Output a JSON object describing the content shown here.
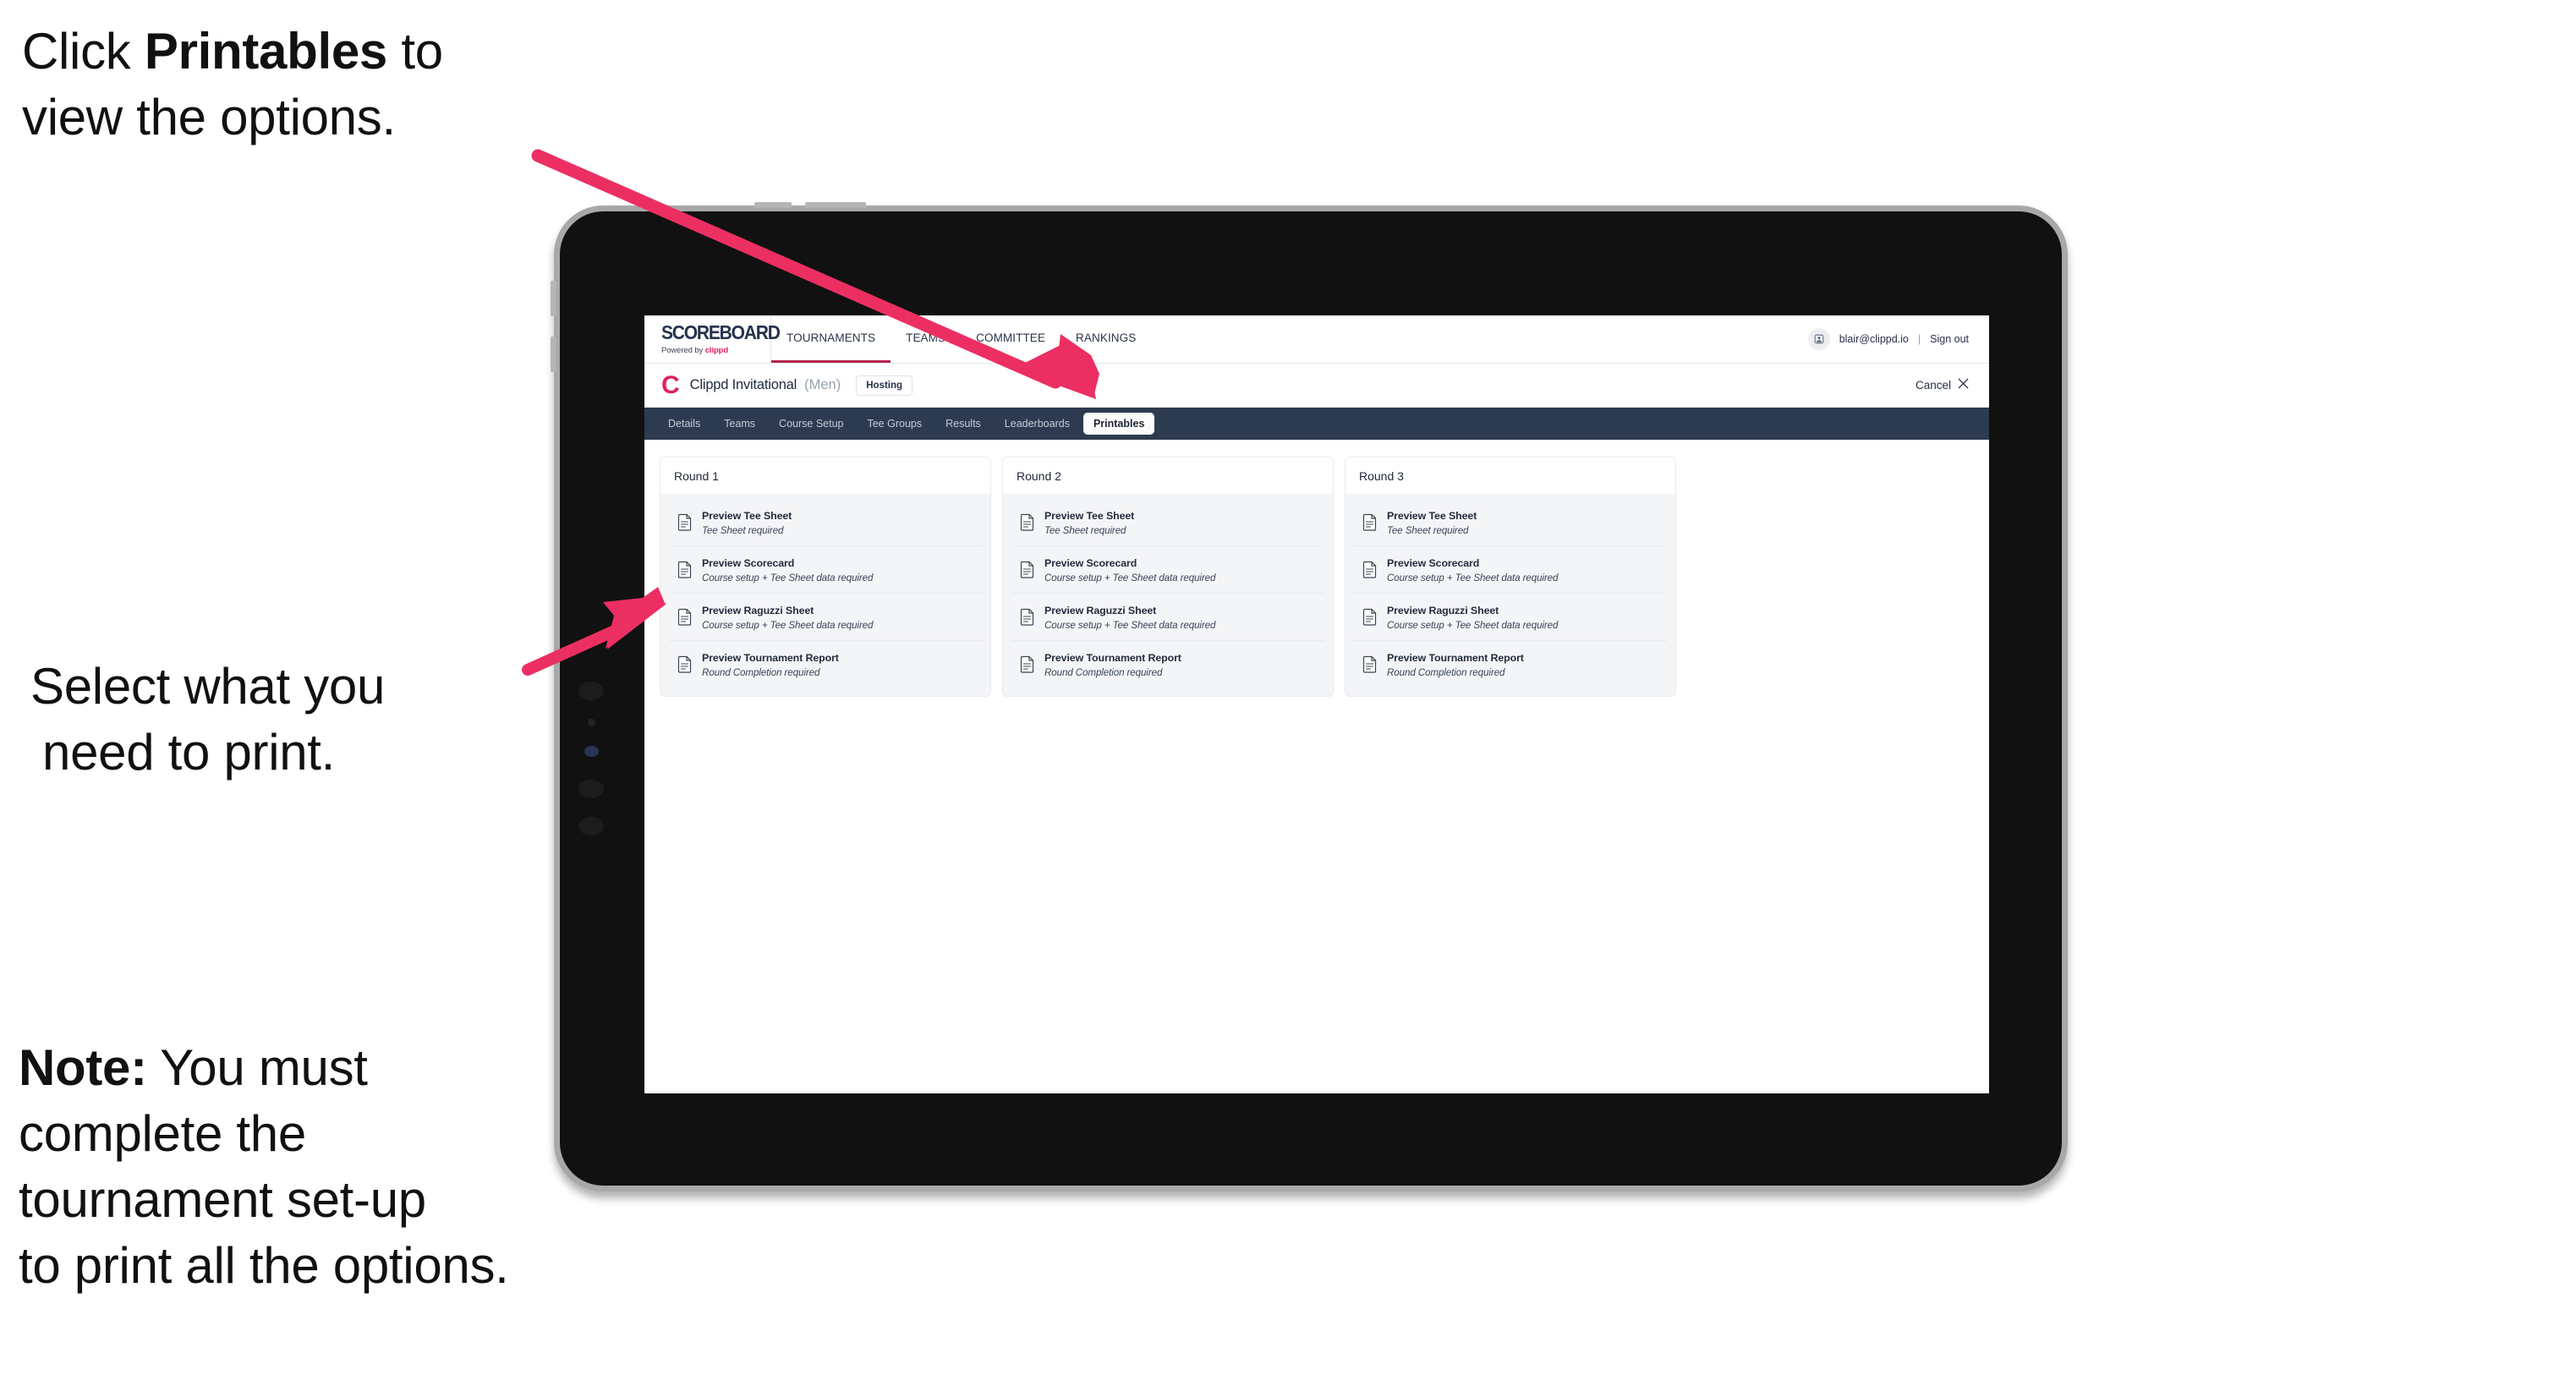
{
  "annotations": {
    "click_printables": "Click ",
    "click_printables_bold": "Printables",
    "click_printables_tail": " to\nview the options.",
    "select_line1": "Select what you",
    "select_line2": "need to print.",
    "note_bold": "Note:",
    "note_text": " You must\ncomplete the\ntournament set-up\nto print all the options."
  },
  "browser": {
    "site_bar": {
      "logo_word": "SCOREBOARD",
      "logo_sub_prefix": "Powered by ",
      "logo_sub_brand": "clippd",
      "nav_items": [
        {
          "label": "TOURNAMENTS",
          "active": true
        },
        {
          "label": "TEAMS",
          "active": false
        },
        {
          "label": "COMMITTEE",
          "active": false
        },
        {
          "label": "RANKINGS",
          "active": false
        }
      ],
      "avatar_icon": "user-avatar-icon",
      "account_email": "blair@clippd.io",
      "divider": "|",
      "sign_out": "Sign out"
    },
    "tournament_bar": {
      "brand_mark": "C",
      "name": "Clippd Invitational",
      "gender": "(Men)",
      "hosting_badge": "Hosting",
      "cancel_label": "Cancel",
      "cancel_icon": "close-x-icon"
    },
    "tabs": [
      {
        "label": "Details",
        "active": false
      },
      {
        "label": "Teams",
        "active": false
      },
      {
        "label": "Course Setup",
        "active": false
      },
      {
        "label": "Tee Groups",
        "active": false
      },
      {
        "label": "Results",
        "active": false
      },
      {
        "label": "Leaderboards",
        "active": false
      },
      {
        "label": "Printables",
        "active": true
      }
    ],
    "rounds": [
      {
        "title": "Round 1",
        "items": [
          {
            "title": "Preview Tee Sheet",
            "requirement": "Tee Sheet required",
            "icon": "document-icon"
          },
          {
            "title": "Preview Scorecard",
            "requirement": "Course setup + Tee Sheet data required",
            "icon": "document-icon"
          },
          {
            "title": "Preview Raguzzi Sheet",
            "requirement": "Course setup + Tee Sheet data required",
            "icon": "document-icon"
          },
          {
            "title": "Preview Tournament Report",
            "requirement": "Round Completion required",
            "icon": "document-icon"
          }
        ]
      },
      {
        "title": "Round 2",
        "items": [
          {
            "title": "Preview Tee Sheet",
            "requirement": "Tee Sheet required",
            "icon": "document-icon"
          },
          {
            "title": "Preview Scorecard",
            "requirement": "Course setup + Tee Sheet data required",
            "icon": "document-icon"
          },
          {
            "title": "Preview Raguzzi Sheet",
            "requirement": "Course setup + Tee Sheet data required",
            "icon": "document-icon"
          },
          {
            "title": "Preview Tournament Report",
            "requirement": "Round Completion required",
            "icon": "document-icon"
          }
        ]
      },
      {
        "title": "Round 3",
        "items": [
          {
            "title": "Preview Tee Sheet",
            "requirement": "Tee Sheet required",
            "icon": "document-icon"
          },
          {
            "title": "Preview Scorecard",
            "requirement": "Course setup + Tee Sheet data required",
            "icon": "document-icon"
          },
          {
            "title": "Preview Raguzzi Sheet",
            "requirement": "Course setup + Tee Sheet data required",
            "icon": "document-icon"
          },
          {
            "title": "Preview Tournament Report",
            "requirement": "Round Completion required",
            "icon": "document-icon"
          }
        ]
      }
    ]
  },
  "colors": {
    "annotation_arrow": "#ec2f63",
    "brand_pink": "#e0225e",
    "tab_bar": "#2d3b50",
    "active_nav_underline": "#b5254d",
    "card_body": "#f4f5f7",
    "device_body": "#111111",
    "device_edge": "#a8a8a8"
  }
}
